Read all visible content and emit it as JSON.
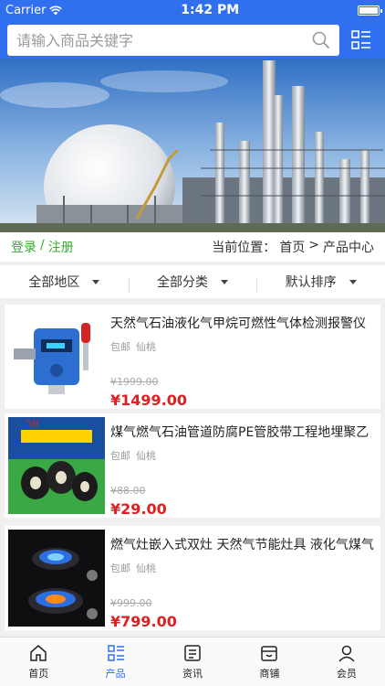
{
  "status": {
    "carrier": "Carrier",
    "time": "1:42 PM"
  },
  "search": {
    "placeholder": "请输入商品关键字"
  },
  "breadcrumb": {
    "login": "登录",
    "sep": "/",
    "register": "注册",
    "current_label": "当前位置：",
    "home": "首页",
    "arrow": ">",
    "current": "产品中心"
  },
  "filters": [
    {
      "label": "全部地区"
    },
    {
      "label": "全部分类"
    },
    {
      "label": "默认排序"
    }
  ],
  "products": [
    {
      "title": "天然气石油液化气甲烷可燃性气体检测报警仪",
      "tag": "包邮",
      "location": "仙桃",
      "old_price": "¥1999.00",
      "price": "¥1499.00"
    },
    {
      "title": "煤气燃气石油管道防腐PE管胶带工程地埋聚乙",
      "tag": "包邮",
      "location": "仙桃",
      "old_price": "¥88.00",
      "price": "¥29.00"
    },
    {
      "title": "燃气灶嵌入式双灶 天然气节能灶具 液化气煤气",
      "tag": "包邮",
      "location": "仙桃",
      "old_price": "¥999.00",
      "price": "¥799.00"
    }
  ],
  "tabs": [
    {
      "label": "首页",
      "icon": "home-icon"
    },
    {
      "label": "产品",
      "icon": "list-icon",
      "active": true
    },
    {
      "label": "资讯",
      "icon": "news-icon"
    },
    {
      "label": "商铺",
      "icon": "shop-icon"
    },
    {
      "label": "会员",
      "icon": "user-icon"
    }
  ],
  "colors": {
    "primary": "#2f6ff0",
    "price": "#e02020",
    "auth": "#3aaa35"
  }
}
